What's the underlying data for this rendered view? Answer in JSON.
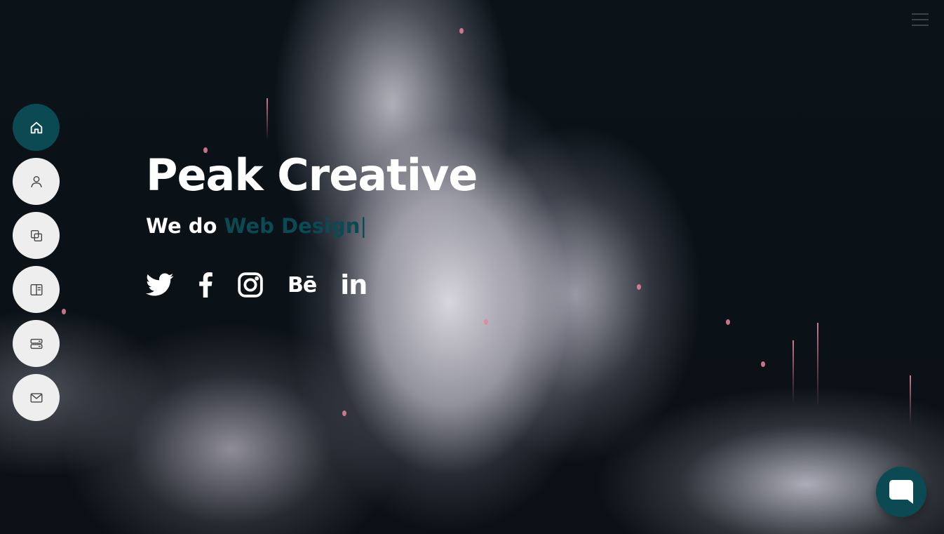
{
  "brand": {
    "title": "Peak Creative",
    "accent_color": "#0b4a52"
  },
  "tagline": {
    "prefix": "We do",
    "typed": "Web Design",
    "cursor": "|"
  },
  "side_nav": {
    "items": [
      {
        "icon": "home-icon",
        "active": true
      },
      {
        "icon": "user-icon",
        "active": false
      },
      {
        "icon": "copy-icon",
        "active": false
      },
      {
        "icon": "book-icon",
        "active": false
      },
      {
        "icon": "server-icon",
        "active": false
      },
      {
        "icon": "mail-icon",
        "active": false
      }
    ]
  },
  "social": {
    "items": [
      {
        "icon": "twitter-icon"
      },
      {
        "icon": "facebook-icon"
      },
      {
        "icon": "instagram-icon"
      },
      {
        "icon": "behance-icon",
        "label": "Bē"
      },
      {
        "icon": "linkedin-icon",
        "label": "in"
      }
    ]
  },
  "menu": {
    "icon": "hamburger-icon"
  },
  "chat": {
    "icon": "chat-icon"
  }
}
